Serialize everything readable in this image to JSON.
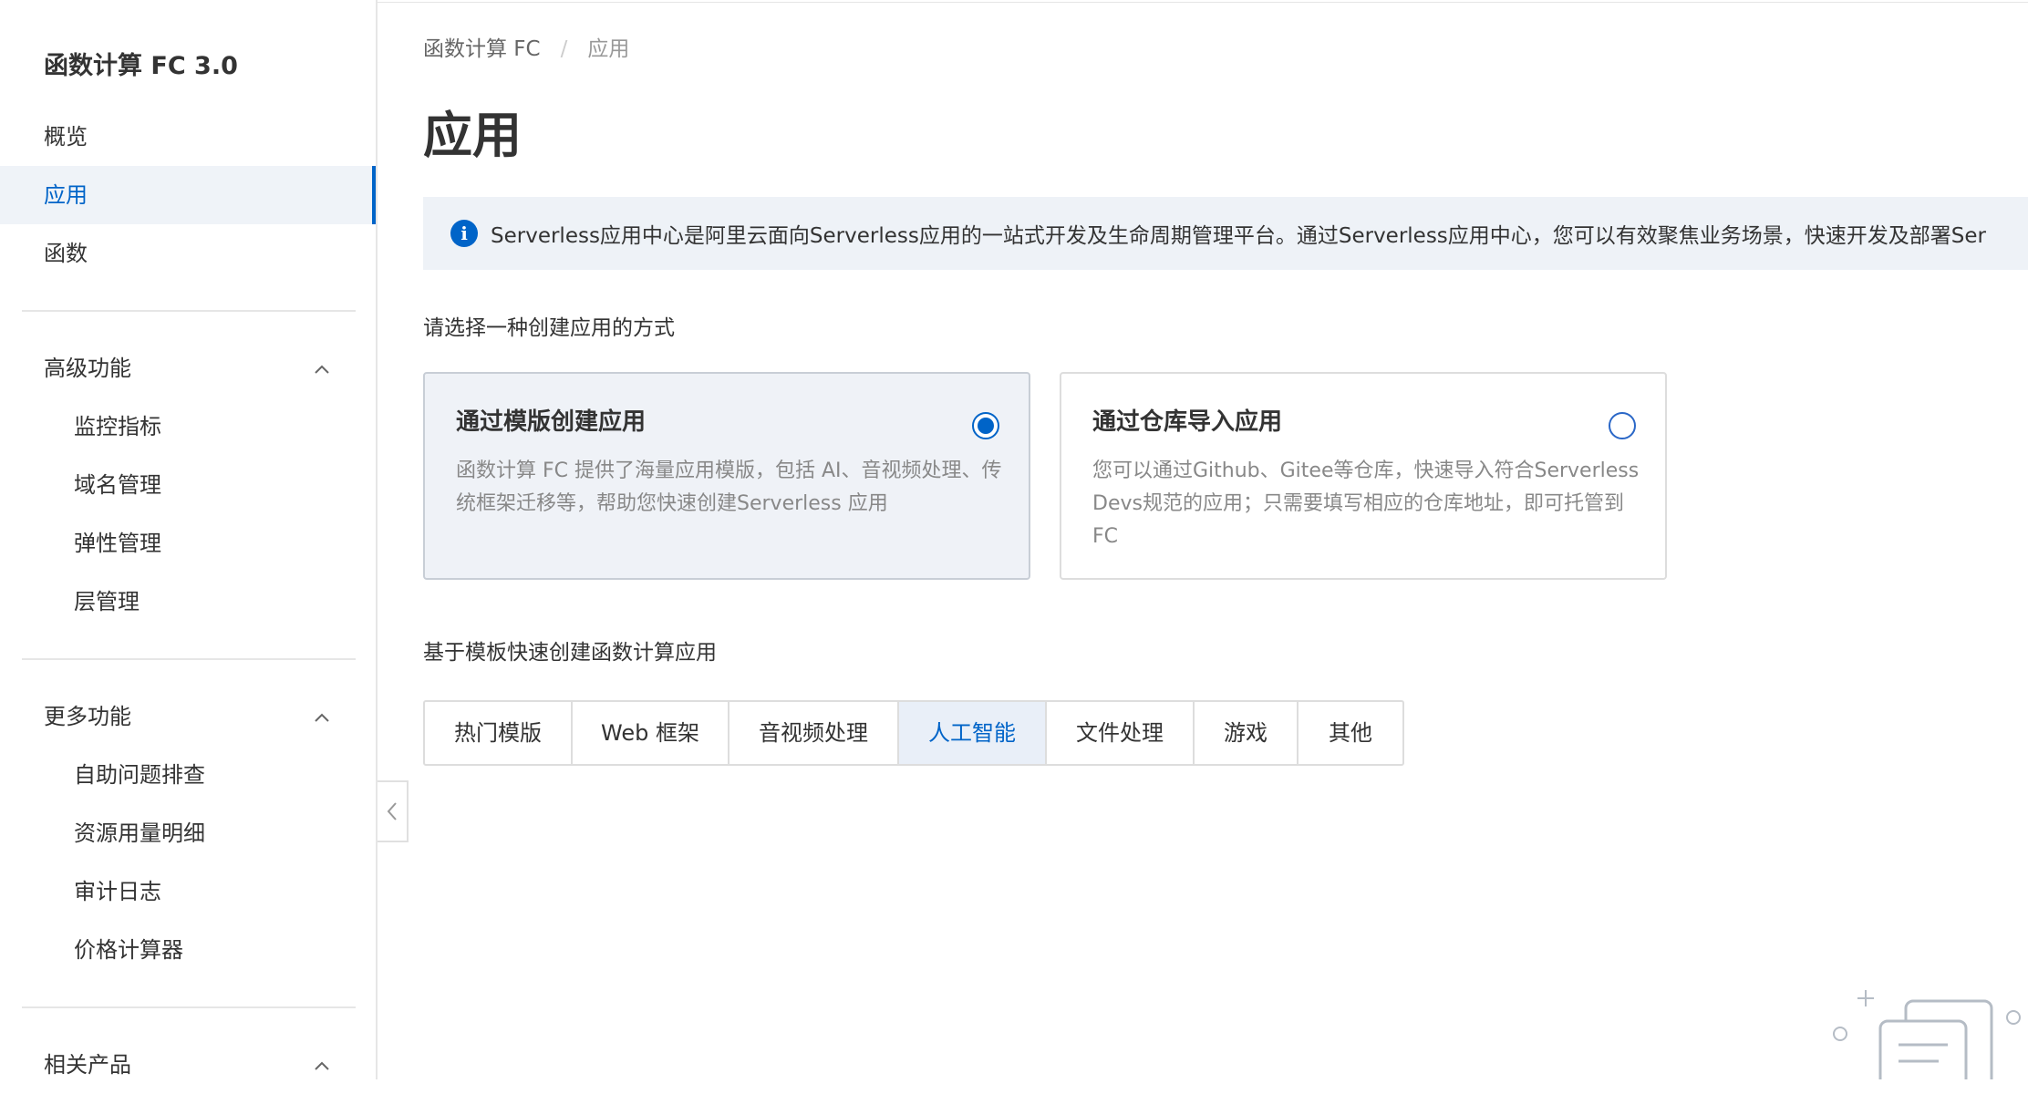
{
  "sidebar": {
    "title": "函数计算 FC 3.0",
    "items": [
      {
        "label": "概览"
      },
      {
        "label": "应用"
      },
      {
        "label": "函数"
      }
    ],
    "groups": [
      {
        "label": "高级功能",
        "items": [
          {
            "label": "监控指标"
          },
          {
            "label": "域名管理"
          },
          {
            "label": "弹性管理"
          },
          {
            "label": "层管理"
          }
        ]
      },
      {
        "label": "更多功能",
        "items": [
          {
            "label": "自助问题排查"
          },
          {
            "label": "资源用量明细"
          },
          {
            "label": "审计日志"
          },
          {
            "label": "价格计算器"
          }
        ]
      },
      {
        "label": "相关产品"
      }
    ]
  },
  "breadcrumb": {
    "root": "函数计算 FC",
    "separator": "/",
    "current": "应用"
  },
  "page": {
    "title": "应用"
  },
  "info": {
    "text": "Serverless应用中心是阿里云面向Serverless应用的一站式开发及生命周期管理平台。通过Serverless应用中心，您可以有效聚焦业务场景，快速开发及部署Ser"
  },
  "create": {
    "label": "请选择一种创建应用的方式",
    "options": [
      {
        "title": "通过模版创建应用",
        "desc": "函数计算 FC 提供了海量应用模版，包括 AI、音视频处理、传统框架迁移等，帮助您快速创建Serverless 应用",
        "selected": true
      },
      {
        "title": "通过仓库导入应用",
        "desc": "您可以通过Github、Gitee等仓库，快速导入符合Serverless Devs规范的应用；只需要填写相应的仓库地址，即可托管到 FC",
        "selected": false
      }
    ]
  },
  "templates": {
    "label": "基于模板快速创建函数计算应用",
    "tabs": [
      {
        "label": "热门模版"
      },
      {
        "label": "Web 框架"
      },
      {
        "label": "音视频处理"
      },
      {
        "label": "人工智能"
      },
      {
        "label": "文件处理"
      },
      {
        "label": "游戏"
      },
      {
        "label": "其他"
      }
    ],
    "active_tab": "人工智能"
  },
  "colors": {
    "accent": "#0064c8",
    "brand": "#ff6a00",
    "selected_bg": "#eff2f7"
  }
}
